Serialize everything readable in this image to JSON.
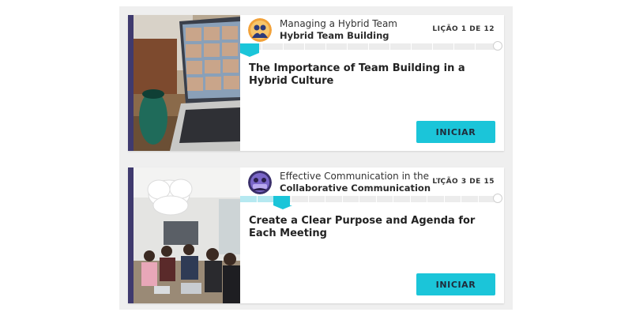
{
  "cards": [
    {
      "course_name": "Managing a Hybrid Team",
      "module_name": "Hybrid Team Building",
      "lesson_count": "LIÇÃO 1 DE 12",
      "lesson_title": "The Importance of Team Building in a Hybrid Culture",
      "start_label": "INICIAR",
      "progress_fraction": 0.083,
      "thumbnail": "laptop-video-call-photo",
      "avatar": "team-avatar-orange"
    },
    {
      "course_name": "Effective Communication in the Work...",
      "module_name": "Collaborative Communication",
      "lesson_count": "LIÇÃO 3 DE 15",
      "lesson_title": "Create a Clear Purpose and Agenda for Each Meeting",
      "start_label": "INICIAR",
      "progress_fraction": 0.2,
      "thumbnail": "meeting-room-photo",
      "avatar": "team-avatar-purple"
    }
  ],
  "colors": {
    "accent": "#3f3a6e",
    "button": "#1bc5d9",
    "progress_fill": "#b6e9f1"
  }
}
